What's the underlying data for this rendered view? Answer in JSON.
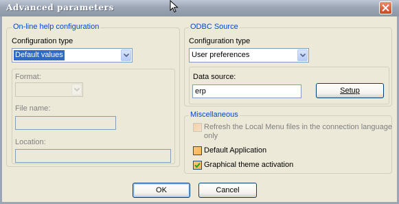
{
  "window": {
    "title": "Advanced parameters"
  },
  "online_help": {
    "group_label": "On-line help configuration",
    "config_type_label": "Configuration type",
    "config_type_value": "Default values",
    "format_label": "Format:",
    "format_value": "",
    "file_name_label": "File name:",
    "file_name_value": "",
    "location_label": "Location:",
    "location_value": ""
  },
  "odbc": {
    "group_label": "ODBC Source",
    "config_type_label": "Configuration type",
    "config_type_value": "User preferences",
    "data_source_label": "Data source:",
    "data_source_value": "erp",
    "setup_button": "Setup"
  },
  "misc": {
    "group_label": "Miscellaneous",
    "refresh_line1": "Refresh the Local Menu files in the connection language",
    "refresh_line2": "only",
    "refresh_checked": false,
    "refresh_enabled": false,
    "default_app_label": "Default Application",
    "default_app_checked": false,
    "graphical_theme_label": "Graphical theme activation",
    "graphical_theme_checked": true
  },
  "footer": {
    "ok_button": "OK",
    "cancel_button": "Cancel"
  },
  "colors": {
    "group_label": "#0046d5",
    "selection": "#316ac5",
    "face": "#ece9d8"
  }
}
